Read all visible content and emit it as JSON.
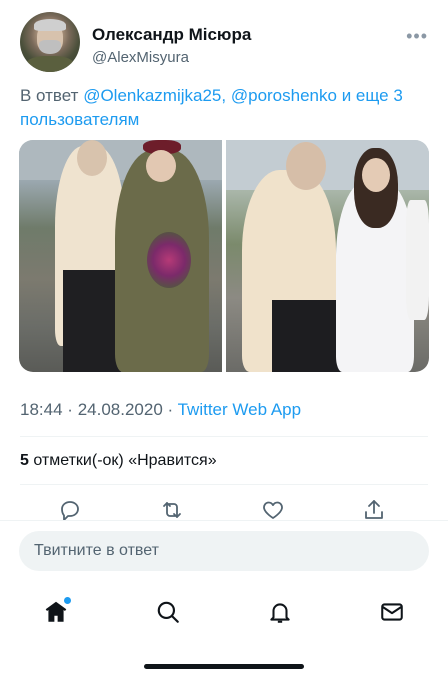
{
  "tweet": {
    "author_name": "Олександр Місюра",
    "author_handle": "@AlexMisyura",
    "reply_prefix": "В ответ",
    "mentions": [
      "@Olenkazmijka25",
      "@poroshenko"
    ],
    "reply_mid": "и еще 3",
    "reply_suffix": "пользователям",
    "time": "18:44",
    "date": "24.08.2020",
    "separator": "·",
    "app": "Twitter Web App",
    "likes_count": "5",
    "likes_label": "отметки(-ок) «Нравится»"
  },
  "icons": {
    "more": "more-icon",
    "reply": "reply-icon",
    "retweet": "retweet-icon",
    "like": "heart-icon",
    "share": "share-icon",
    "home": "home-icon",
    "search": "search-icon",
    "notifications": "bell-icon",
    "messages": "mail-icon"
  },
  "compose": {
    "placeholder": "Твитните в ответ"
  },
  "colors": {
    "accent": "#1d9bf0",
    "text": "#0f1419",
    "muted": "#536471"
  }
}
